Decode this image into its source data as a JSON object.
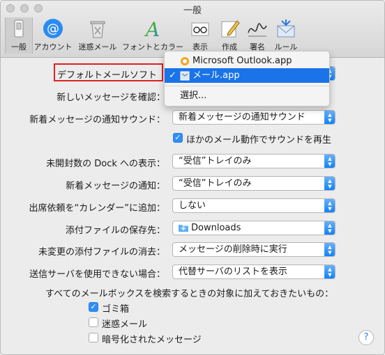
{
  "window": {
    "title": "一般"
  },
  "toolbar": {
    "items": [
      {
        "label": "一般",
        "icon": "switch-icon"
      },
      {
        "label": "アカウント",
        "icon": "at-sign-icon"
      },
      {
        "label": "迷惑メール",
        "icon": "junk-trash-icon"
      },
      {
        "label": "フォントとカラー",
        "icon": "font-color-icon"
      },
      {
        "label": "表示",
        "icon": "glasses-icon"
      },
      {
        "label": "作成",
        "icon": "compose-pencil-icon"
      },
      {
        "label": "署名",
        "icon": "signature-icon"
      },
      {
        "label": "ルール",
        "icon": "rules-envelope-icon"
      }
    ]
  },
  "settings": {
    "default_mail_label": "デフォルトメールソフト",
    "check_mail_label": "新しいメッセージを確認：",
    "sound_label": "新着メッセージの通知サウンド：",
    "sound_value": "新着メッセージの通知サウンド",
    "play_sound_checkbox": "ほかのメール動作でサウンドを再生",
    "dock_label": "未開封数の Dock への表示：",
    "dock_value": "“受信”トレイのみ",
    "notify_label": "新着メッセージの通知：",
    "notify_value": "“受信”トレイのみ",
    "calendar_label": "出席依頼を“カレンダー”に追加：",
    "calendar_value": "しない",
    "download_label": "添付ファイルの保存先：",
    "download_value": "Downloads",
    "remove_label": "未変更の添付ファイルの消去：",
    "remove_value": "メッセージの削除時に実行",
    "server_label": "送信サーバを使用できない場合：",
    "server_value": "代替サーバのリストを表示",
    "search_heading": "すべてのメールボックスを検索するときの対象に加えておきたいもの：",
    "trash_checkbox": "ゴミ箱",
    "junk_checkbox": "迷惑メール",
    "encrypted_checkbox": "暗号化されたメッセージ",
    "help": "?"
  },
  "menu": {
    "items": [
      "Microsoft Outlook.app",
      "メール.app",
      "選択..."
    ],
    "checkmark": "✓"
  },
  "colors": {
    "accent": "#1a73e8",
    "highlight_border": "#e02020"
  }
}
